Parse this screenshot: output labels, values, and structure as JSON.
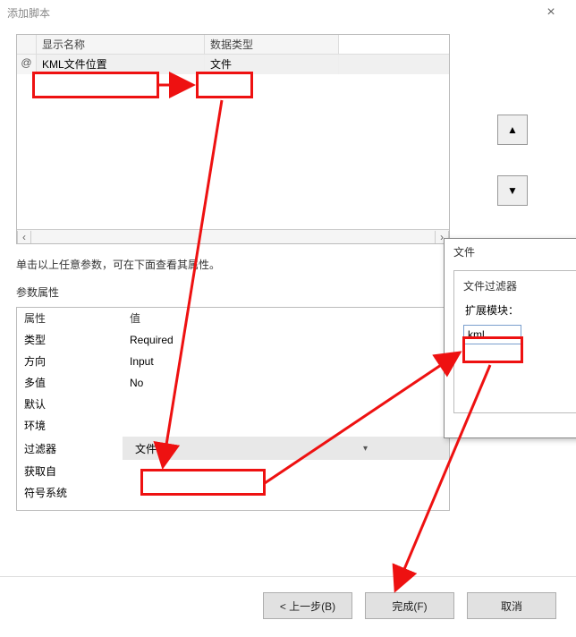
{
  "titlebar": {
    "title": "添加脚本"
  },
  "grid": {
    "headers": {
      "name": "显示名称",
      "type": "数据类型"
    },
    "row_marker": "@",
    "rows": [
      {
        "name": "KML文件位置",
        "type": "文件"
      }
    ]
  },
  "hint": "单击以上任意参数，可在下面查看其属性。",
  "params": {
    "section_label": "参数属性",
    "header": {
      "attr": "属性",
      "val": "值"
    },
    "rows": {
      "type": {
        "label": "类型",
        "value": "Required"
      },
      "dir": {
        "label": "方向",
        "value": "Input"
      },
      "multi": {
        "label": "多值",
        "value": "No"
      },
      "default": {
        "label": "默认",
        "value": ""
      },
      "env": {
        "label": "环境",
        "value": ""
      },
      "filter": {
        "label": "过滤器",
        "value": "文件"
      },
      "from": {
        "label": "获取自",
        "value": ""
      },
      "symbol": {
        "label": "符号系统",
        "value": ""
      }
    }
  },
  "popup": {
    "title": "文件",
    "subtitle": "文件过滤器",
    "ext_label": "扩展模块：",
    "ext_value": "kml"
  },
  "buttons": {
    "back": "< 上一步(B)",
    "finish": "完成(F)",
    "cancel": "取消"
  }
}
